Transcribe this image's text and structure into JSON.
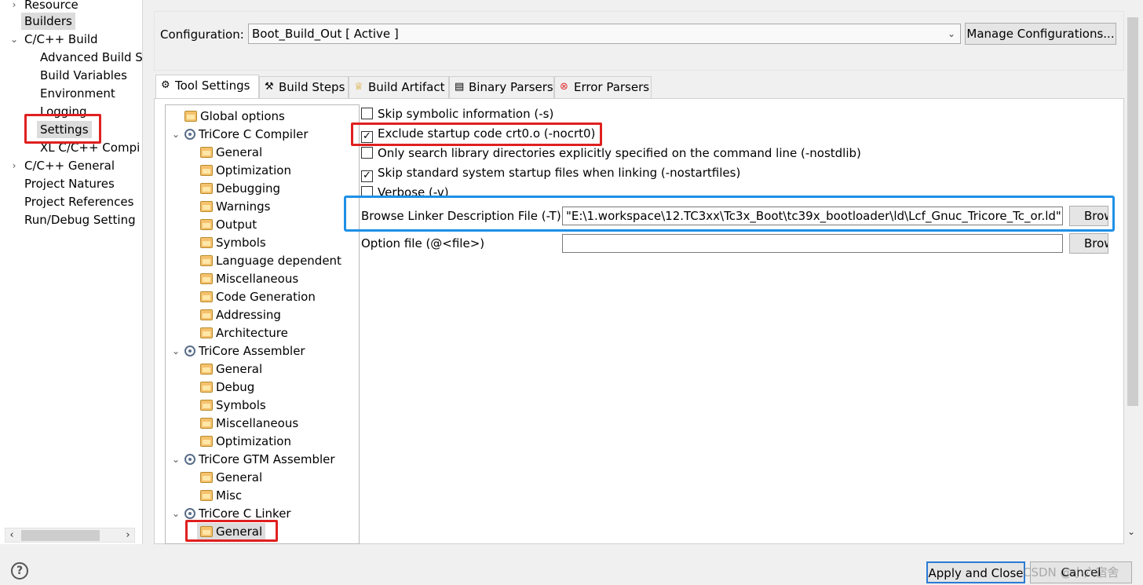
{
  "nav": {
    "items": [
      {
        "label": "Resource",
        "expander": "collapsed"
      },
      {
        "label": "Builders",
        "expander": ""
      },
      {
        "label": "C/C++ Build",
        "expander": "expanded"
      },
      {
        "label": "Advanced Build S",
        "expander": ""
      },
      {
        "label": "Build Variables",
        "expander": ""
      },
      {
        "label": "Environment",
        "expander": ""
      },
      {
        "label": "Logging",
        "expander": ""
      },
      {
        "label": "Settings",
        "expander": ""
      },
      {
        "label": "XL C/C++ Compi",
        "expander": ""
      },
      {
        "label": "C/C++ General",
        "expander": "collapsed"
      },
      {
        "label": "Project Natures",
        "expander": ""
      },
      {
        "label": "Project References",
        "expander": ""
      },
      {
        "label": "Run/Debug Setting",
        "expander": ""
      }
    ]
  },
  "config": {
    "label": "Configuration:",
    "value": "Boot_Build_Out  [ Active ]",
    "manage_label": "Manage Configurations..."
  },
  "tabs": [
    {
      "label": "Tool Settings",
      "icon": "tool-settings-icon"
    },
    {
      "label": "Build Steps",
      "icon": "build-steps-icon"
    },
    {
      "label": "Build Artifact",
      "icon": "build-artifact-icon"
    },
    {
      "label": "Binary Parsers",
      "icon": "binary-parsers-icon"
    },
    {
      "label": "Error Parsers",
      "icon": "error-parsers-icon"
    }
  ],
  "tree": {
    "items": [
      {
        "label": "Global options"
      },
      {
        "label": "TriCore C Compiler"
      },
      {
        "label": "General"
      },
      {
        "label": "Optimization"
      },
      {
        "label": "Debugging"
      },
      {
        "label": "Warnings"
      },
      {
        "label": "Output"
      },
      {
        "label": "Symbols"
      },
      {
        "label": "Language dependent"
      },
      {
        "label": "Miscellaneous"
      },
      {
        "label": "Code Generation"
      },
      {
        "label": "Addressing"
      },
      {
        "label": "Architecture"
      },
      {
        "label": "TriCore Assembler"
      },
      {
        "label": "General"
      },
      {
        "label": "Debug"
      },
      {
        "label": "Symbols"
      },
      {
        "label": "Miscellaneous"
      },
      {
        "label": "Optimization"
      },
      {
        "label": "TriCore GTM Assembler"
      },
      {
        "label": "General"
      },
      {
        "label": "Misc"
      },
      {
        "label": "TriCore C Linker"
      },
      {
        "label": "General"
      }
    ]
  },
  "options": {
    "skip_symbolic": {
      "label": "Skip symbolic information (-s)",
      "checked": false
    },
    "exclude_startup": {
      "label": "Exclude startup code crt0.o (-nocrt0)",
      "checked": true
    },
    "only_search": {
      "label": "Only search library directories explicitly specified on the command line (-nostdlib)",
      "checked": false
    },
    "skip_standard": {
      "label": "Skip standard system startup files when linking (-nostartfiles)",
      "checked": true
    },
    "verbose": {
      "label": "Verbose (-v)",
      "checked": false
    }
  },
  "linker_file": {
    "label": "Browse Linker Description File (-T)",
    "value": "\"E:\\1.workspace\\12.TC3xx\\Tc3x_Boot\\tc39x_bootloader\\ld\\Lcf_Gnuc_Tricore_Tc_or.ld\"",
    "browse_label": "Brow"
  },
  "option_file": {
    "label": "Option file (@<file>)",
    "value": "",
    "browse_label": "Brow"
  },
  "footer": {
    "help": "?",
    "apply_label": "Apply and Close",
    "cancel_label": "Cancel",
    "watermark": "CSDN @小六宿舍"
  },
  "colors": {
    "highlight_red": "#e02020",
    "highlight_blue": "#1e90e6"
  }
}
